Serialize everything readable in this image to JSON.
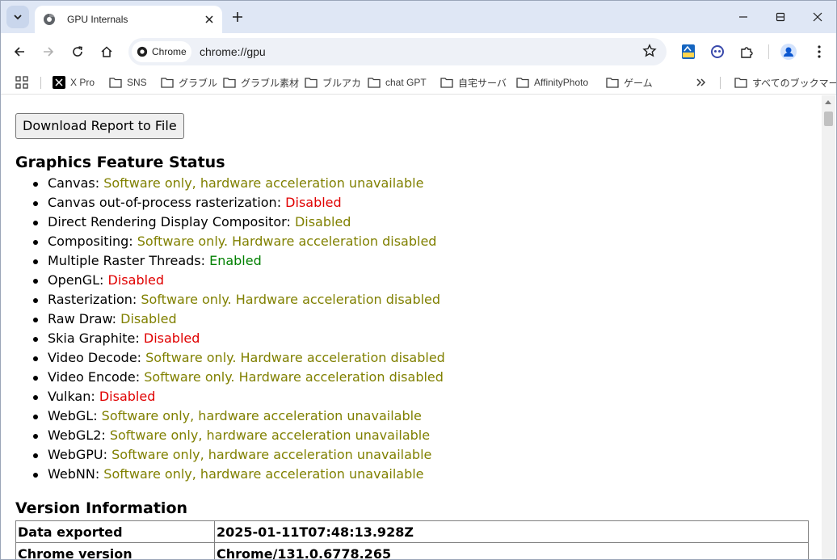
{
  "tab": {
    "title": "GPU Internals"
  },
  "omnibox": {
    "chip_label": "Chrome",
    "url": "chrome://gpu"
  },
  "bookmarks": [
    {
      "label": "X Pro",
      "icon": "x-logo-icon"
    },
    {
      "label": "SNS",
      "icon": "folder-icon"
    },
    {
      "label": "グラブル",
      "icon": "folder-icon"
    },
    {
      "label": "グラブル素材",
      "icon": "folder-icon"
    },
    {
      "label": "ブルアカ",
      "icon": "folder-icon"
    },
    {
      "label": "chat GPT",
      "icon": "folder-icon"
    },
    {
      "label": "自宅サーバ",
      "icon": "folder-icon"
    },
    {
      "label": "AffinityPhoto",
      "icon": "folder-icon"
    },
    {
      "label": "ゲーム",
      "icon": "folder-icon"
    }
  ],
  "all_bookmarks_label": "すべてのブックマーク",
  "page": {
    "download_button": "Download Report to File",
    "feature_heading": "Graphics Feature Status",
    "features": [
      {
        "name": "Canvas: ",
        "status": "Software only, hardware acceleration unavailable",
        "level": "warn"
      },
      {
        "name": "Canvas out-of-process rasterization: ",
        "status": "Disabled",
        "level": "bad"
      },
      {
        "name": "Direct Rendering Display Compositor: ",
        "status": "Disabled",
        "level": "warn"
      },
      {
        "name": "Compositing: ",
        "status": "Software only. Hardware acceleration disabled",
        "level": "warn"
      },
      {
        "name": "Multiple Raster Threads: ",
        "status": "Enabled",
        "level": "good"
      },
      {
        "name": "OpenGL: ",
        "status": "Disabled",
        "level": "bad"
      },
      {
        "name": "Rasterization: ",
        "status": "Software only. Hardware acceleration disabled",
        "level": "warn"
      },
      {
        "name": "Raw Draw: ",
        "status": "Disabled",
        "level": "warn"
      },
      {
        "name": "Skia Graphite: ",
        "status": "Disabled",
        "level": "bad"
      },
      {
        "name": "Video Decode: ",
        "status": "Software only. Hardware acceleration disabled",
        "level": "warn"
      },
      {
        "name": "Video Encode: ",
        "status": "Software only. Hardware acceleration disabled",
        "level": "warn"
      },
      {
        "name": "Vulkan: ",
        "status": "Disabled",
        "level": "bad"
      },
      {
        "name": "WebGL: ",
        "status": "Software only, hardware acceleration unavailable",
        "level": "warn"
      },
      {
        "name": "WebGL2: ",
        "status": "Software only, hardware acceleration unavailable",
        "level": "warn"
      },
      {
        "name": "WebGPU: ",
        "status": "Software only, hardware acceleration unavailable",
        "level": "warn"
      },
      {
        "name": "WebNN: ",
        "status": "Software only, hardware acceleration unavailable",
        "level": "warn"
      }
    ],
    "version_heading": "Version Information",
    "version_rows": [
      {
        "key": "Data exported",
        "value": "2025-01-11T07:48:13.928Z"
      },
      {
        "key": "Chrome version",
        "value": "Chrome/131.0.6778.265"
      }
    ]
  },
  "colors": {
    "warn": "#808000",
    "bad": "#e00000",
    "good": "#008000",
    "accent": "#1a73e8"
  }
}
